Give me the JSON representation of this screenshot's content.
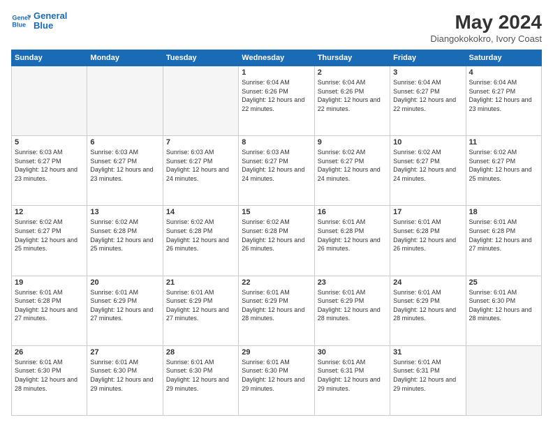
{
  "header": {
    "logo_line1": "General",
    "logo_line2": "Blue",
    "month_year": "May 2024",
    "location": "Diangokokokro, Ivory Coast"
  },
  "weekdays": [
    "Sunday",
    "Monday",
    "Tuesday",
    "Wednesday",
    "Thursday",
    "Friday",
    "Saturday"
  ],
  "weeks": [
    [
      {
        "day": "",
        "empty": true
      },
      {
        "day": "",
        "empty": true
      },
      {
        "day": "",
        "empty": true
      },
      {
        "day": "1",
        "sunrise": "6:04 AM",
        "sunset": "6:26 PM",
        "daylight": "12 hours and 22 minutes."
      },
      {
        "day": "2",
        "sunrise": "6:04 AM",
        "sunset": "6:26 PM",
        "daylight": "12 hours and 22 minutes."
      },
      {
        "day": "3",
        "sunrise": "6:04 AM",
        "sunset": "6:27 PM",
        "daylight": "12 hours and 22 minutes."
      },
      {
        "day": "4",
        "sunrise": "6:04 AM",
        "sunset": "6:27 PM",
        "daylight": "12 hours and 23 minutes."
      }
    ],
    [
      {
        "day": "5",
        "sunrise": "6:03 AM",
        "sunset": "6:27 PM",
        "daylight": "12 hours and 23 minutes."
      },
      {
        "day": "6",
        "sunrise": "6:03 AM",
        "sunset": "6:27 PM",
        "daylight": "12 hours and 23 minutes."
      },
      {
        "day": "7",
        "sunrise": "6:03 AM",
        "sunset": "6:27 PM",
        "daylight": "12 hours and 24 minutes."
      },
      {
        "day": "8",
        "sunrise": "6:03 AM",
        "sunset": "6:27 PM",
        "daylight": "12 hours and 24 minutes."
      },
      {
        "day": "9",
        "sunrise": "6:02 AM",
        "sunset": "6:27 PM",
        "daylight": "12 hours and 24 minutes."
      },
      {
        "day": "10",
        "sunrise": "6:02 AM",
        "sunset": "6:27 PM",
        "daylight": "12 hours and 24 minutes."
      },
      {
        "day": "11",
        "sunrise": "6:02 AM",
        "sunset": "6:27 PM",
        "daylight": "12 hours and 25 minutes."
      }
    ],
    [
      {
        "day": "12",
        "sunrise": "6:02 AM",
        "sunset": "6:27 PM",
        "daylight": "12 hours and 25 minutes."
      },
      {
        "day": "13",
        "sunrise": "6:02 AM",
        "sunset": "6:28 PM",
        "daylight": "12 hours and 25 minutes."
      },
      {
        "day": "14",
        "sunrise": "6:02 AM",
        "sunset": "6:28 PM",
        "daylight": "12 hours and 26 minutes."
      },
      {
        "day": "15",
        "sunrise": "6:02 AM",
        "sunset": "6:28 PM",
        "daylight": "12 hours and 26 minutes."
      },
      {
        "day": "16",
        "sunrise": "6:01 AM",
        "sunset": "6:28 PM",
        "daylight": "12 hours and 26 minutes."
      },
      {
        "day": "17",
        "sunrise": "6:01 AM",
        "sunset": "6:28 PM",
        "daylight": "12 hours and 26 minutes."
      },
      {
        "day": "18",
        "sunrise": "6:01 AM",
        "sunset": "6:28 PM",
        "daylight": "12 hours and 27 minutes."
      }
    ],
    [
      {
        "day": "19",
        "sunrise": "6:01 AM",
        "sunset": "6:28 PM",
        "daylight": "12 hours and 27 minutes."
      },
      {
        "day": "20",
        "sunrise": "6:01 AM",
        "sunset": "6:29 PM",
        "daylight": "12 hours and 27 minutes."
      },
      {
        "day": "21",
        "sunrise": "6:01 AM",
        "sunset": "6:29 PM",
        "daylight": "12 hours and 27 minutes."
      },
      {
        "day": "22",
        "sunrise": "6:01 AM",
        "sunset": "6:29 PM",
        "daylight": "12 hours and 28 minutes."
      },
      {
        "day": "23",
        "sunrise": "6:01 AM",
        "sunset": "6:29 PM",
        "daylight": "12 hours and 28 minutes."
      },
      {
        "day": "24",
        "sunrise": "6:01 AM",
        "sunset": "6:29 PM",
        "daylight": "12 hours and 28 minutes."
      },
      {
        "day": "25",
        "sunrise": "6:01 AM",
        "sunset": "6:30 PM",
        "daylight": "12 hours and 28 minutes."
      }
    ],
    [
      {
        "day": "26",
        "sunrise": "6:01 AM",
        "sunset": "6:30 PM",
        "daylight": "12 hours and 28 minutes."
      },
      {
        "day": "27",
        "sunrise": "6:01 AM",
        "sunset": "6:30 PM",
        "daylight": "12 hours and 29 minutes."
      },
      {
        "day": "28",
        "sunrise": "6:01 AM",
        "sunset": "6:30 PM",
        "daylight": "12 hours and 29 minutes."
      },
      {
        "day": "29",
        "sunrise": "6:01 AM",
        "sunset": "6:30 PM",
        "daylight": "12 hours and 29 minutes."
      },
      {
        "day": "30",
        "sunrise": "6:01 AM",
        "sunset": "6:31 PM",
        "daylight": "12 hours and 29 minutes."
      },
      {
        "day": "31",
        "sunrise": "6:01 AM",
        "sunset": "6:31 PM",
        "daylight": "12 hours and 29 minutes."
      },
      {
        "day": "",
        "empty": true
      }
    ]
  ],
  "labels": {
    "sunrise": "Sunrise:",
    "sunset": "Sunset:",
    "daylight": "Daylight:"
  }
}
